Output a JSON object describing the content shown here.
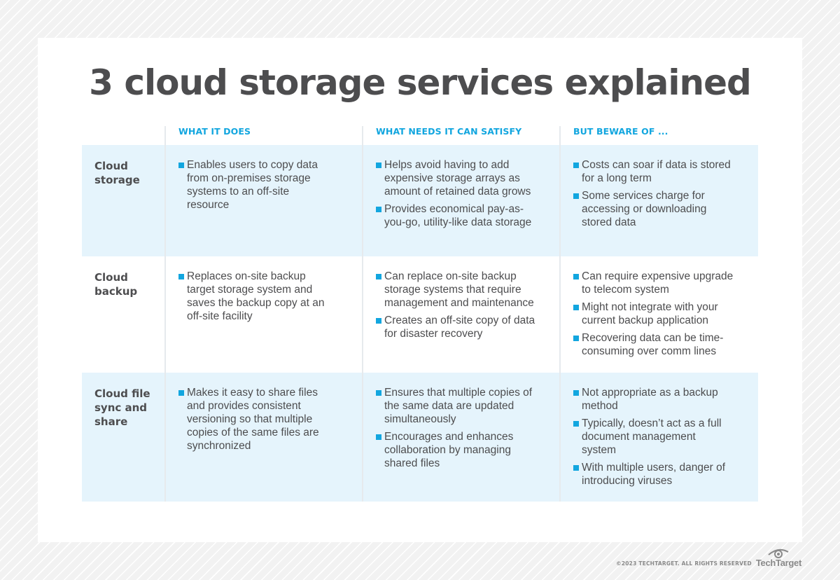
{
  "title": "3 cloud storage services explained",
  "columns": [
    "WHAT IT DOES",
    "WHAT NEEDS IT CAN SATISFY",
    "BUT BEWARE OF ..."
  ],
  "accent_color": "#12a6df",
  "row_shade_color": "#e5f4fc",
  "rows": [
    {
      "label": "Cloud storage",
      "what_it_does": [
        "Enables users to copy data from on-premises storage systems to an off-site resource"
      ],
      "needs": [
        "Helps avoid having to add expensive storage arrays as amount of retained data grows",
        "Provides economical pay-as-you-go, utility-like data storage"
      ],
      "beware": [
        "Costs can soar if data is stored for a long term",
        "Some services charge for accessing or downloading stored data"
      ]
    },
    {
      "label": "Cloud backup",
      "what_it_does": [
        "Replaces on-site backup target storage system and saves the backup copy at an off-site facility"
      ],
      "needs": [
        "Can replace on-site backup storage systems that require management and maintenance",
        "Creates an off-site copy of data for disaster recovery"
      ],
      "beware": [
        "Can require expensive upgrade to telecom system",
        "Might not integrate with your current backup application",
        "Recovering data can be time-consuming over comm lines"
      ]
    },
    {
      "label": "Cloud file sync and share",
      "what_it_does": [
        "Makes it easy to share files and provides consistent versioning so that multiple copies of the same files are synchronized"
      ],
      "needs": [
        "Ensures that multiple copies of the same data are updated simultaneously",
        "Encourages and enhances collaboration by managing shared files"
      ],
      "beware": [
        "Not appropriate as a backup method",
        "Typically, doesn’t act as a full document management system",
        "With multiple users, danger of introducing viruses"
      ]
    }
  ],
  "footer": {
    "copyright": "©2023 TECHTARGET. ALL RIGHTS RESERVED",
    "logo_text": "TechTarget",
    "logo_icon": "eye-icon"
  }
}
